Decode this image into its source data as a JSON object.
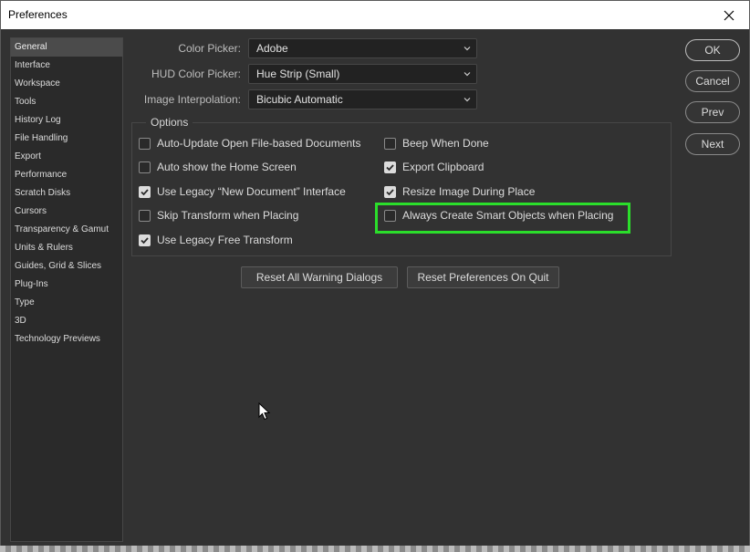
{
  "window": {
    "title": "Preferences"
  },
  "sidebar": {
    "selected_index": 0,
    "items": [
      {
        "label": "General"
      },
      {
        "label": "Interface"
      },
      {
        "label": "Workspace"
      },
      {
        "label": "Tools"
      },
      {
        "label": "History Log"
      },
      {
        "label": "File Handling"
      },
      {
        "label": "Export"
      },
      {
        "label": "Performance"
      },
      {
        "label": "Scratch Disks"
      },
      {
        "label": "Cursors"
      },
      {
        "label": "Transparency & Gamut"
      },
      {
        "label": "Units & Rulers"
      },
      {
        "label": "Guides, Grid & Slices"
      },
      {
        "label": "Plug-Ins"
      },
      {
        "label": "Type"
      },
      {
        "label": "3D"
      },
      {
        "label": "Technology Previews"
      }
    ]
  },
  "fields": {
    "color_picker": {
      "label": "Color Picker:",
      "value": "Adobe"
    },
    "hud_color_picker": {
      "label": "HUD Color Picker:",
      "value": "Hue Strip (Small)"
    },
    "image_interpolation": {
      "label": "Image Interpolation:",
      "value": "Bicubic Automatic"
    }
  },
  "options": {
    "legend": "Options",
    "left": [
      {
        "label": "Auto-Update Open File-based Documents",
        "checked": false
      },
      {
        "label": "Auto show the Home Screen",
        "checked": false
      },
      {
        "label": "Use Legacy “New Document” Interface",
        "checked": true
      },
      {
        "label": "Skip Transform when Placing",
        "checked": false
      },
      {
        "label": "Use Legacy Free Transform",
        "checked": true
      }
    ],
    "right": [
      {
        "label": "Beep When Done",
        "checked": false
      },
      {
        "label": "Export Clipboard",
        "checked": true
      },
      {
        "label": "Resize Image During Place",
        "checked": true
      },
      {
        "label": "Always Create Smart Objects when Placing",
        "checked": false
      }
    ]
  },
  "actions": {
    "reset_warnings": "Reset All Warning Dialogs",
    "reset_prefs": "Reset Preferences On Quit"
  },
  "dialog_buttons": {
    "ok": "OK",
    "cancel": "Cancel",
    "prev": "Prev",
    "next": "Next"
  },
  "colors": {
    "highlight": "#2bde2b",
    "panel": "#323232",
    "sidebar_selected": "#4b4b4b"
  },
  "icons": {
    "close": "close-icon",
    "dropdown": "chevron-down-icon",
    "check": "checkmark-icon",
    "cursor": "mouse-pointer-icon"
  }
}
